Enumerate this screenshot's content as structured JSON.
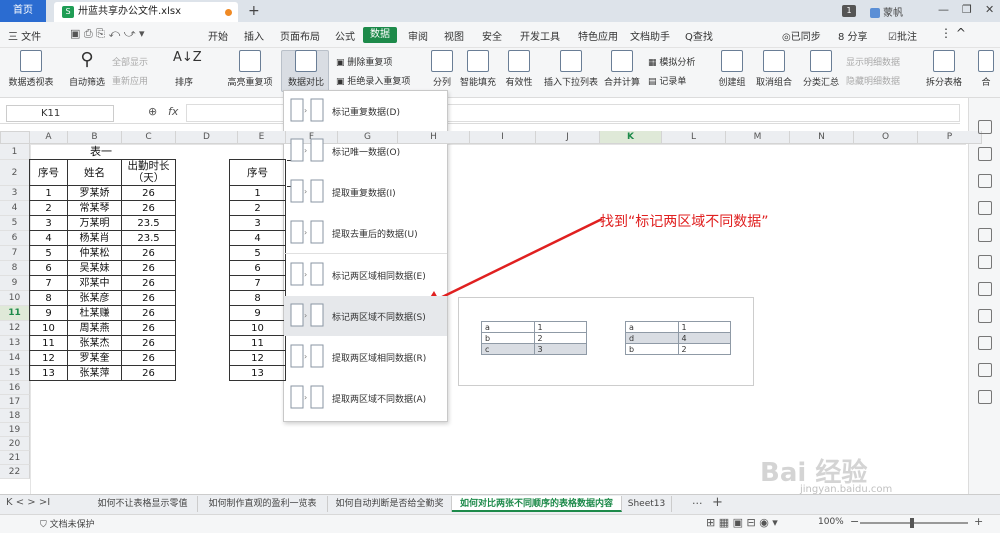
{
  "tabs": {
    "home": "首页",
    "file": "卅蓝共享办公文件.xlsx",
    "plus": "+"
  },
  "titlebar": {
    "count_badge": "1",
    "user": "蒙帆"
  },
  "menu": {
    "file": "三 文件",
    "items": [
      "开始",
      "插入",
      "页面布局",
      "公式",
      "数据",
      "审阅",
      "视图",
      "安全",
      "开发工具",
      "特色应用",
      "文档助手",
      "Q查找"
    ],
    "active": "数据",
    "right": [
      "◎已同步",
      "8 分享",
      "☑批注"
    ]
  },
  "ribbon": {
    "pivot": "数据透视表",
    "autofilter": "自动筛选",
    "show_all": "全部显示",
    "reapply": "重新应用",
    "sort": "排序",
    "highlight_dup": "高亮重复项",
    "compare": "数据对比",
    "remove_dup": "删除重复项",
    "reject_dup": "拒绝录入重复项",
    "split": "分列",
    "smart_fill": "智能填充",
    "validity": "有效性",
    "dropdown_list": "插入下拉列表",
    "merge_calc": "合并计算",
    "simulate": "模拟分析",
    "record": "记录单",
    "create_group": "创建组",
    "ungroup": "取消组合",
    "subtotal": "分类汇总",
    "show_detail": "显示明细数据",
    "hide_detail": "隐藏明细数据",
    "split_table": "拆分表格",
    "more": "合"
  },
  "formula_bar": {
    "name_box": "K11",
    "fx": "fx"
  },
  "grid": {
    "columns": [
      "A",
      "B",
      "C",
      "D",
      "E",
      "F",
      "G",
      "H",
      "I",
      "J",
      "K",
      "L",
      "M",
      "N",
      "O",
      "P"
    ],
    "selected_col": "K",
    "selected_row": "11",
    "rows": [
      "1",
      "2",
      "3",
      "4",
      "5",
      "6",
      "7",
      "8",
      "9",
      "10",
      "11",
      "12",
      "13",
      "14",
      "15",
      "16",
      "17",
      "18",
      "19",
      "20",
      "21",
      "22"
    ]
  },
  "table1": {
    "title": "表一",
    "headers": [
      "序号",
      "姓名",
      "出勤时长\n（天）"
    ],
    "rows": [
      [
        "1",
        "罗某娇",
        "26"
      ],
      [
        "2",
        "常某琴",
        "26"
      ],
      [
        "3",
        "万某明",
        "23.5"
      ],
      [
        "4",
        "杨某肖",
        "23.5"
      ],
      [
        "5",
        "仲某松",
        "26"
      ],
      [
        "6",
        "吴某妹",
        "26"
      ],
      [
        "7",
        "邓某中",
        "26"
      ],
      [
        "8",
        "张某彦",
        "26"
      ],
      [
        "9",
        "杜某赚",
        "26"
      ],
      [
        "10",
        "周某燕",
        "26"
      ],
      [
        "11",
        "张某杰",
        "26"
      ],
      [
        "12",
        "罗某奎",
        "26"
      ],
      [
        "13",
        "张某萍",
        "26"
      ]
    ]
  },
  "table2": {
    "header": "序号",
    "rows": [
      "1",
      "2",
      "3",
      "4",
      "5",
      "6",
      "7",
      "8",
      "9",
      "10",
      "11",
      "12",
      "13"
    ]
  },
  "dropdown": {
    "items": [
      "标记重复数据(D)",
      "标记唯一数据(O)",
      "提取重复数据(I)",
      "提取去重后的数据(U)",
      "标记两区域相同数据(E)",
      "标记两区域不同数据(S)",
      "提取两区域相同数据(R)",
      "提取两区域不同数据(A)"
    ],
    "highlighted": "标记两区域不同数据(S)"
  },
  "preview": {
    "left": [
      [
        "a",
        "1"
      ],
      [
        "b",
        "2"
      ],
      [
        "c",
        "3"
      ]
    ],
    "right": [
      [
        "a",
        "1"
      ],
      [
        "d",
        "4"
      ],
      [
        "b",
        "2"
      ]
    ]
  },
  "annotation": "找到“标记两区域不同数据”",
  "sheets": {
    "tabs": [
      "如何不让表格显示零值",
      "如何制作直观的盈利一览表",
      "如何自动判断是否给全勤奖",
      "如何对比两张不同顺序的表格数据内容",
      "Sheet13"
    ],
    "active": "如何对比两张不同顺序的表格数据内容"
  },
  "status": {
    "protect": "文档未保护",
    "zoom": "100%"
  },
  "watermark": "Bai 经验",
  "watermark_url": "jingyan.baidu.com",
  "colors": {
    "accent": "#1d8a4a",
    "home_tab": "#2b6cd1",
    "annotation": "#e02020"
  }
}
